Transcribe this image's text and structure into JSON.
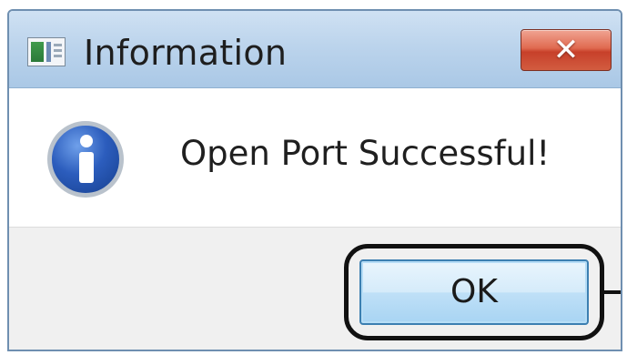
{
  "window": {
    "title": "Information",
    "close_label": "✕",
    "app_icon": "window-icon"
  },
  "content": {
    "icon": "info-icon",
    "message": "Open Port Successful!"
  },
  "footer": {
    "ok_label": "OK"
  },
  "colors": {
    "titlebar": "#bcd4ec",
    "close_button": "#d25c40",
    "ok_button": "#cfe8fa",
    "info_icon": "#2c5dbd",
    "highlight": "#111111"
  }
}
